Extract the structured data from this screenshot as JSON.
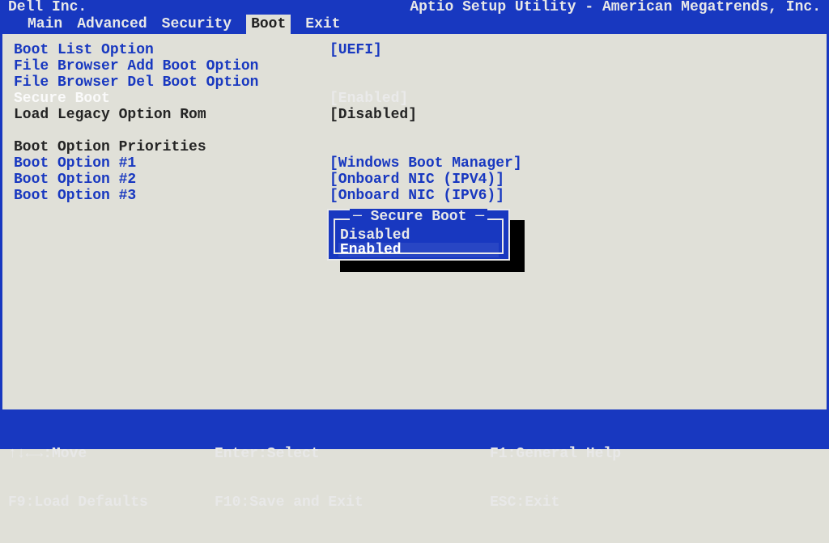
{
  "header": {
    "vendor": "Dell Inc.",
    "title": "Aptio Setup Utility - American Megatrends, Inc."
  },
  "tabs": {
    "items": [
      {
        "label": "Main"
      },
      {
        "label": "Advanced"
      },
      {
        "label": "Security"
      },
      {
        "label": "Boot"
      },
      {
        "label": "Exit"
      }
    ],
    "active": "Boot"
  },
  "settings": {
    "boot_list_option": {
      "label": "Boot List Option",
      "value": "[UEFI]"
    },
    "file_add": {
      "label": "File Browser Add Boot Option"
    },
    "file_del": {
      "label": "File Browser Del Boot Option"
    },
    "secure_boot": {
      "label": "Secure Boot",
      "value": "[Enabled]"
    },
    "load_legacy": {
      "label": "Load Legacy Option Rom",
      "value": "[Disabled]"
    },
    "priorities_header": "Boot Option Priorities",
    "opt1": {
      "label": "Boot Option #1",
      "value": "[Windows Boot Manager]"
    },
    "opt2": {
      "label": "Boot Option #2",
      "value": "[Onboard NIC (IPV4)]"
    },
    "opt3": {
      "label": "Boot Option #3",
      "value": "[Onboard NIC (IPV6)]"
    }
  },
  "popup": {
    "title": "Secure Boot",
    "options": {
      "disabled": "Disabled",
      "enabled": "Enabled"
    },
    "selected": "Enabled"
  },
  "footer": {
    "move": "↑↓←→:Move",
    "load_defaults": "F9:Load Defaults",
    "select": "Enter:Select",
    "save_exit": "F10:Save and Exit",
    "help": "F1:General Help",
    "exit": "ESC:Exit"
  }
}
